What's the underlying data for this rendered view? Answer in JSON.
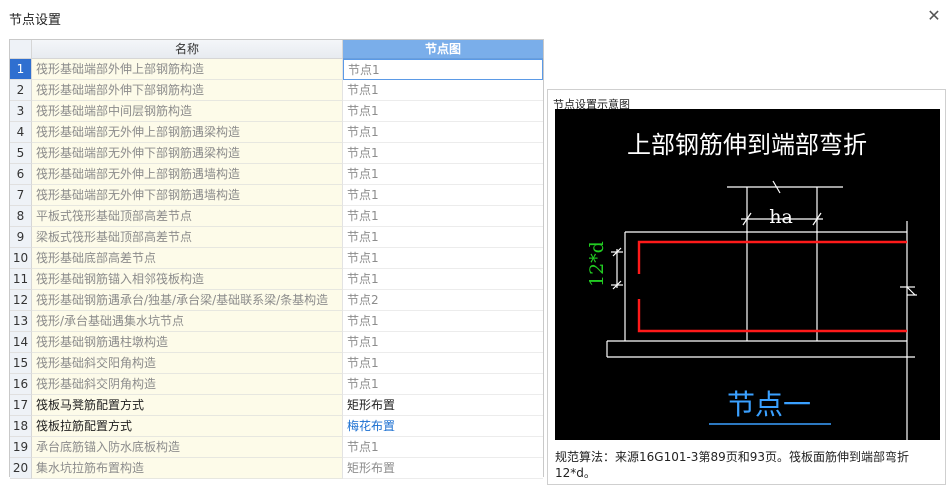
{
  "window": {
    "title": "节点设置",
    "close_glyph": "✕"
  },
  "grid": {
    "col_name": "名称",
    "col_node": "节点图",
    "rows": [
      {
        "n": "1",
        "name": "筏形基础端部外伸上部钢筋构造",
        "node": "节点1"
      },
      {
        "n": "2",
        "name": "筏形基础端部外伸下部钢筋构造",
        "node": "节点1"
      },
      {
        "n": "3",
        "name": "筏形基础端部中间层钢筋构造",
        "node": "节点1"
      },
      {
        "n": "4",
        "name": "筏形基础端部无外伸上部钢筋遇梁构造",
        "node": "节点1"
      },
      {
        "n": "5",
        "name": "筏形基础端部无外伸下部钢筋遇梁构造",
        "node": "节点1"
      },
      {
        "n": "6",
        "name": "筏形基础端部无外伸上部钢筋遇墙构造",
        "node": "节点1"
      },
      {
        "n": "7",
        "name": "筏形基础端部无外伸下部钢筋遇墙构造",
        "node": "节点1"
      },
      {
        "n": "8",
        "name": "平板式筏形基础顶部高差节点",
        "node": "节点1"
      },
      {
        "n": "9",
        "name": "梁板式筏形基础顶部高差节点",
        "node": "节点1"
      },
      {
        "n": "10",
        "name": "筏形基础底部高差节点",
        "node": "节点1"
      },
      {
        "n": "11",
        "name": "筏形基础钢筋锚入相邻筏板构造",
        "node": "节点1"
      },
      {
        "n": "12",
        "name": "筏形基础钢筋遇承台/独基/承台梁/基础联系梁/条基构造",
        "node": "节点2"
      },
      {
        "n": "13",
        "name": "筏形/承台基础遇集水坑节点",
        "node": "节点1"
      },
      {
        "n": "14",
        "name": "筏形基础钢筋遇柱墩构造",
        "node": "节点1"
      },
      {
        "n": "15",
        "name": "筏形基础斜交阳角构造",
        "node": "节点1"
      },
      {
        "n": "16",
        "name": "筏形基础斜交阴角构造",
        "node": "节点1"
      },
      {
        "n": "17",
        "name": "筏板马凳筋配置方式",
        "node": "矩形布置"
      },
      {
        "n": "18",
        "name": "筏板拉筋配置方式",
        "node": "梅花布置"
      },
      {
        "n": "19",
        "name": "承台底筋锚入防水底板构造",
        "node": "节点1"
      },
      {
        "n": "20",
        "name": "集水坑拉筋布置构造",
        "node": "矩形布置"
      }
    ]
  },
  "preview": {
    "label": "节点设置示意图",
    "diagram_title": "上部钢筋伸到端部弯折",
    "dim_ha": "ha",
    "dim_12d": "12*d",
    "node_name": "节点一",
    "description": "规范算法：来源16G101-3第89页和93页。筏板面筋伸到端部弯折12*d。"
  },
  "colors": {
    "rebar": "#ff1a1a",
    "dim_green": "#22cc22",
    "node_name": "#3aa0ff",
    "header_accent": "#7aaeea"
  }
}
